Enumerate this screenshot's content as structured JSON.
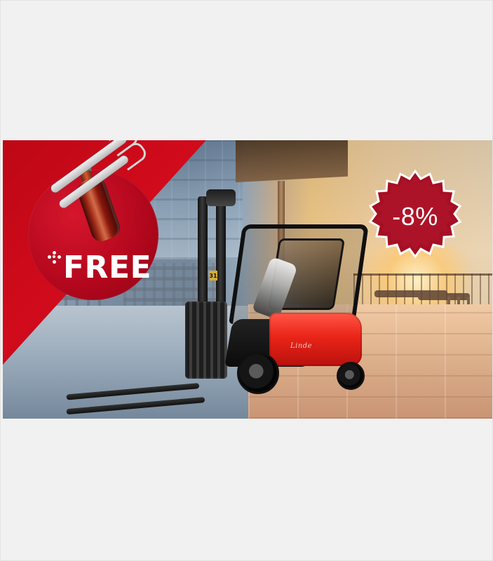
{
  "banner": {
    "free_text": "FREE",
    "discount_text": "-8%",
    "brand_text": "Linde",
    "mast_number": "31"
  },
  "colors": {
    "promo_red": "#c30a1a",
    "discount_red": "#a50f24",
    "white": "#ffffff",
    "forklift_red": "#e52818"
  },
  "icons": {
    "gift_bottle": "sauce-bottle-icon",
    "gift_utensil": "bbq-tongs-icon",
    "free_sparkle": "sparkle-icon",
    "discount_shape": "starburst-badge-icon"
  }
}
